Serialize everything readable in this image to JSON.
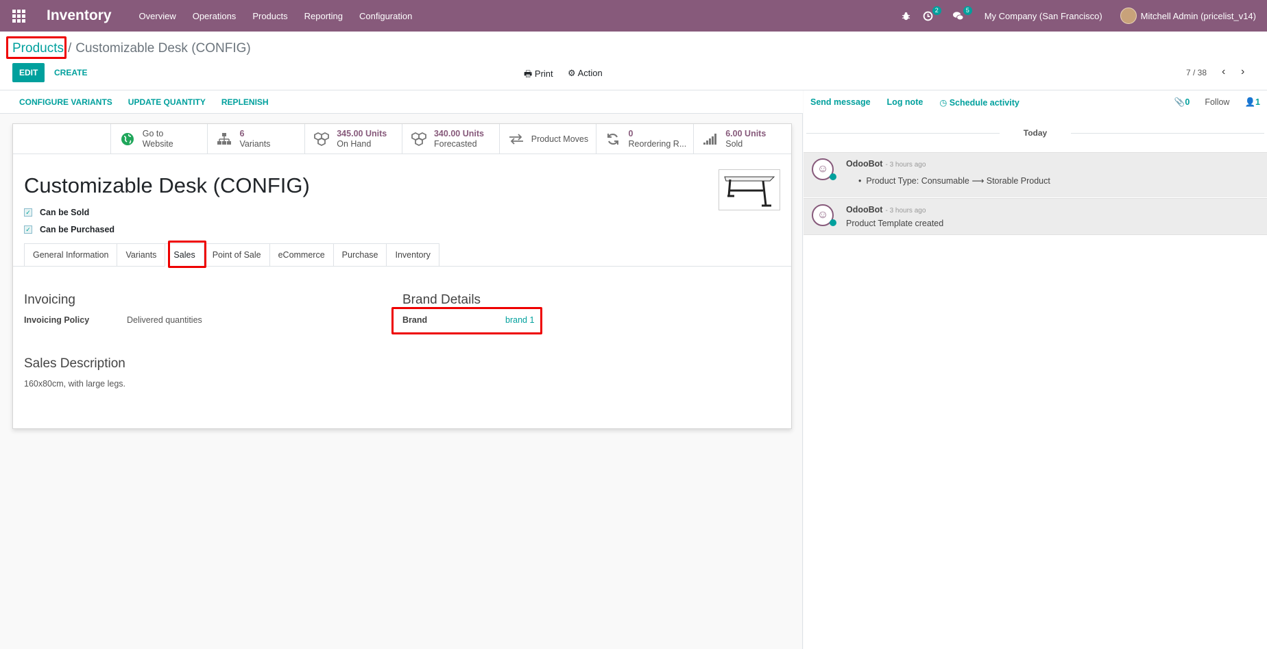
{
  "navbar": {
    "app_title": "Inventory",
    "menu": [
      "Overview",
      "Operations",
      "Products",
      "Reporting",
      "Configuration"
    ],
    "activity_count": "2",
    "messages_count": "5",
    "company": "My Company (San Francisco)",
    "user": "Mitchell Admin (pricelist_v14)"
  },
  "breadcrumb": {
    "parent": "Products",
    "separator": "/",
    "current": "Customizable Desk (CONFIG)"
  },
  "control": {
    "edit_label": "EDIT",
    "create_label": "CREATE",
    "print_label": "Print",
    "action_label": "Action",
    "pager": "7 / 38"
  },
  "statusbar": [
    "CONFIGURE VARIANTS",
    "UPDATE QUANTITY",
    "REPLENISH"
  ],
  "smart_buttons": [
    {
      "value": "",
      "label": "Go to",
      "label2": "Website",
      "icon": "globe-icon"
    },
    {
      "value": "6",
      "label": "Variants",
      "icon": "sitemap-icon"
    },
    {
      "value": "345.00 Units",
      "label": "On Hand",
      "icon": "cubes-icon"
    },
    {
      "value": "340.00 Units",
      "label": "Forecasted",
      "icon": "cubes-icon"
    },
    {
      "value": "",
      "label": "Product Moves",
      "icon": "exchange-icon"
    },
    {
      "value": "0",
      "label": "Reordering R...",
      "icon": "refresh-icon"
    },
    {
      "value": "6.00 Units",
      "label": "Sold",
      "icon": "signal-icon"
    }
  ],
  "product": {
    "name": "Customizable Desk (CONFIG)",
    "can_be_sold": "Can be Sold",
    "can_be_purchased": "Can be Purchased"
  },
  "tabs": [
    "General Information",
    "Variants",
    "Sales",
    "Point of Sale",
    "eCommerce",
    "Purchase",
    "Inventory"
  ],
  "active_tab": "Sales",
  "sales": {
    "invoicing_title": "Invoicing",
    "invoicing_policy_label": "Invoicing Policy",
    "invoicing_policy_value": "Delivered quantities",
    "brand_title": "Brand Details",
    "brand_label": "Brand",
    "brand_value": "brand 1",
    "description_title": "Sales Description",
    "description_value": "160x80cm, with large legs."
  },
  "chatter": {
    "send_message": "Send message",
    "log_note": "Log note",
    "schedule_activity": "Schedule activity",
    "attachments": "0",
    "follow": "Follow",
    "followers": "1",
    "today": "Today",
    "messages": [
      {
        "author": "OdooBot",
        "date": "- 3 hours ago",
        "body": "Product Type: Consumable ⟶ Storable Product"
      },
      {
        "author": "OdooBot",
        "date": "- 3 hours ago",
        "body": "Product Template created"
      }
    ]
  },
  "colors": {
    "brand": "#875a7b",
    "accent": "#00a09d",
    "highlight": "#ee0000"
  }
}
